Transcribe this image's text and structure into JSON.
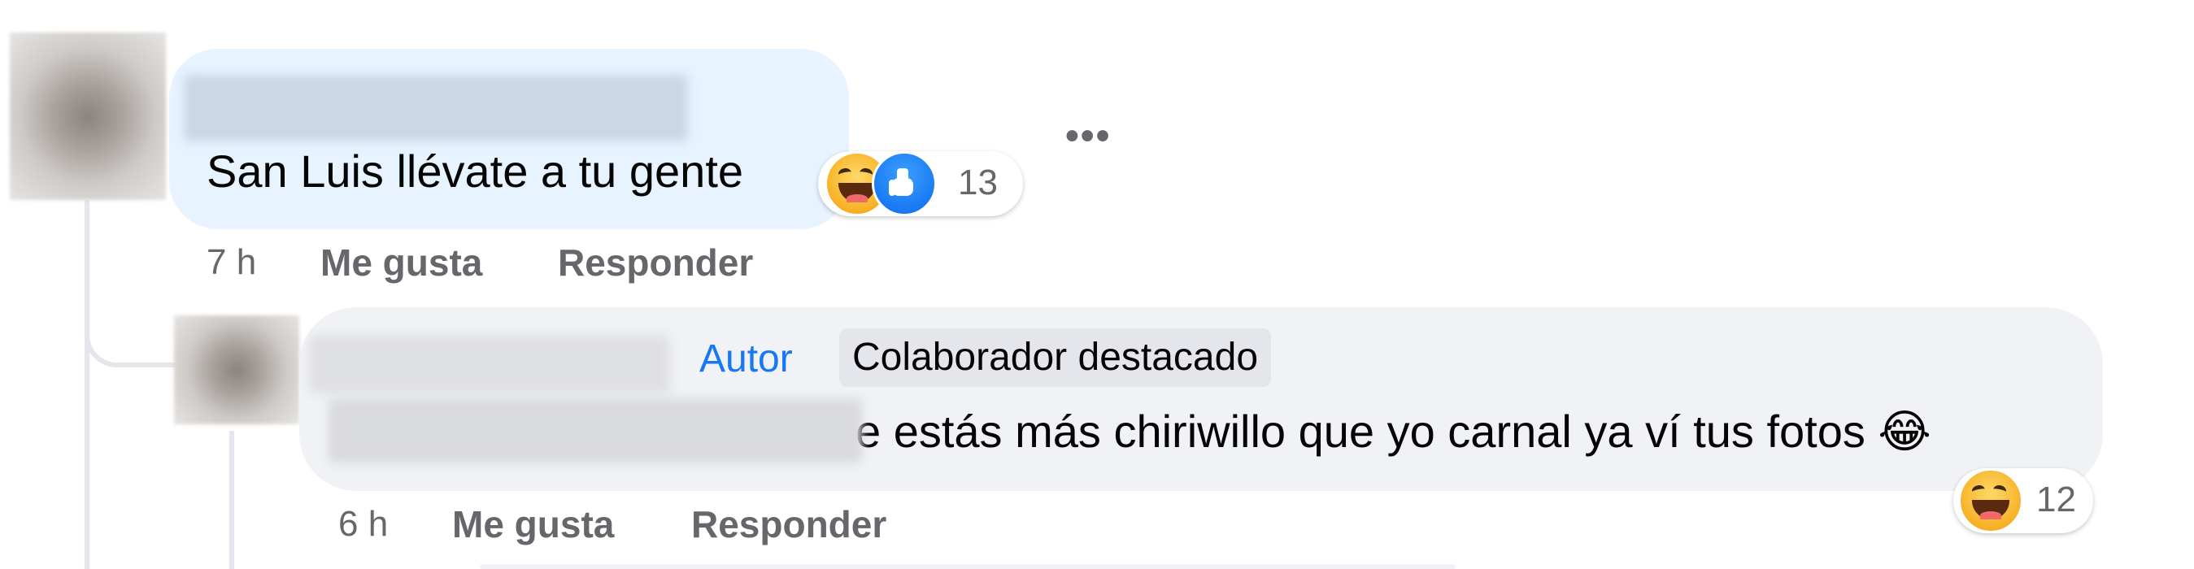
{
  "comment": {
    "author_name": "",
    "text": "San Luis llévate a tu gente",
    "reaction_count": "13",
    "reactions": [
      "haha",
      "like"
    ],
    "time": "7 h",
    "like_label": "Me gusta",
    "reply_label": "Responder",
    "more_label": "•••"
  },
  "reply": {
    "author_name": "",
    "author_badge": "Autor",
    "contributor_badge": "Colaborador destacado",
    "text": "e estás más chiriwillo que yo carnal ya ví tus fotos 😂",
    "reaction_count": "12",
    "reactions": [
      "haha"
    ],
    "time": "6 h",
    "like_label": "Me gusta",
    "reply_label": "Responder"
  },
  "colors": {
    "bubble_main": "#e7f3ff",
    "bubble_reply": "#f0f2f5",
    "badge_author": "#1877f2",
    "meta": "#65676b"
  }
}
